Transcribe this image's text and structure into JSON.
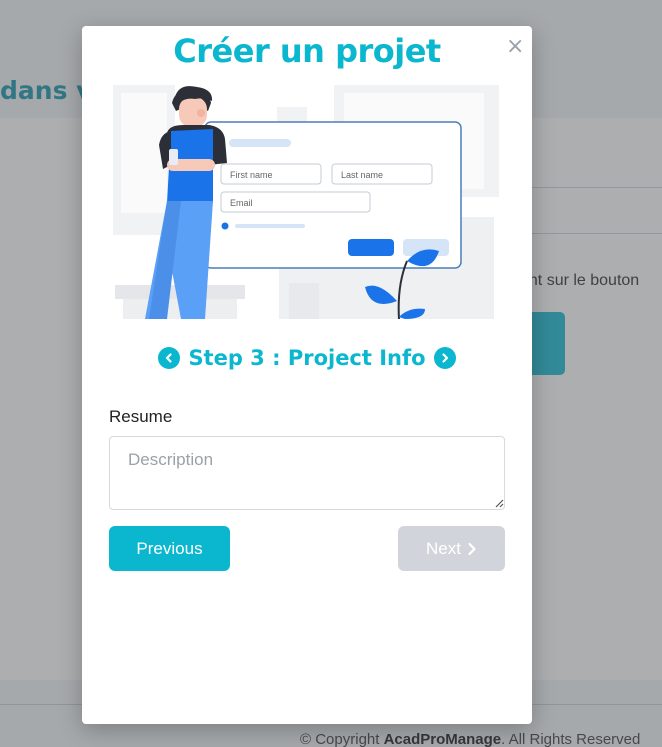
{
  "background": {
    "heading_fragment": "dans v",
    "instruction_fragment": "ant sur le bouton",
    "footer": {
      "prefix": "© Copyright ",
      "brand": "AcadProManage",
      "suffix": ". All Rights Reserved"
    }
  },
  "modal": {
    "title": "Créer un projet",
    "close_symbol": "×",
    "illustration": {
      "form_first_name": "First name",
      "form_last_name": "Last name",
      "form_email": "Email"
    },
    "step": {
      "title": "Step 3 : Project Info",
      "prev_icon": "chevron-left-icon",
      "next_icon": "chevron-right-icon"
    },
    "resume": {
      "label": "Resume",
      "placeholder": "Description",
      "value": ""
    },
    "buttons": {
      "previous": "Previous",
      "next": "Next"
    }
  },
  "colors": {
    "accent": "#0ab7cf",
    "disabled": "#d1d5db",
    "overlay": "rgba(90,93,98,0.5)"
  }
}
